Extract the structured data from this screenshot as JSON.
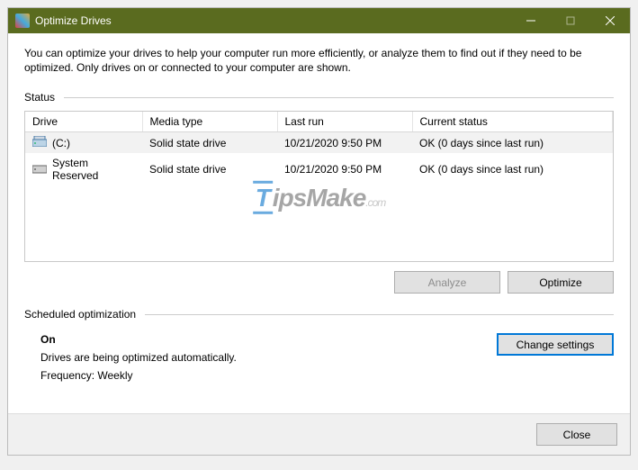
{
  "window": {
    "title": "Optimize Drives"
  },
  "description": "You can optimize your drives to help your computer run more efficiently, or analyze them to find out if they need to be optimized. Only drives on or connected to your computer are shown.",
  "status": {
    "label": "Status",
    "columns": {
      "drive": "Drive",
      "mediaType": "Media type",
      "lastRun": "Last run",
      "currentStatus": "Current status"
    },
    "rows": [
      {
        "drive": "(C:)",
        "iconType": "local",
        "mediaType": "Solid state drive",
        "lastRun": "10/21/2020 9:50 PM",
        "currentStatus": "OK (0 days since last run)",
        "selected": true
      },
      {
        "drive": "System Reserved",
        "iconType": "system",
        "mediaType": "Solid state drive",
        "lastRun": "10/21/2020 9:50 PM",
        "currentStatus": "OK (0 days since last run)",
        "selected": false
      }
    ]
  },
  "buttons": {
    "analyze": "Analyze",
    "optimize": "Optimize",
    "changeSettings": "Change settings",
    "close": "Close"
  },
  "scheduled": {
    "label": "Scheduled optimization",
    "state": "On",
    "detail": "Drives are being optimized automatically.",
    "frequency": "Frequency: Weekly"
  },
  "watermark": {
    "prefix": "T",
    "main": "ipsMake",
    "suffix": ".com"
  }
}
